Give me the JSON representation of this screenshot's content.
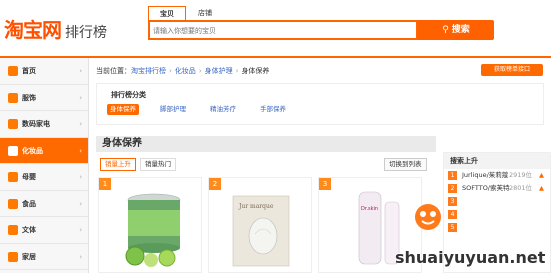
{
  "header": {
    "logo_main": "淘宝网",
    "logo_sub": "排行榜",
    "search_tabs": [
      "宝贝",
      "店铺"
    ],
    "search_placeholder": "请输入你想要的宝贝",
    "search_button": "搜索"
  },
  "sidebar": {
    "items": [
      {
        "label": "首页",
        "arrow": "›"
      },
      {
        "label": "服饰",
        "arrow": "›"
      },
      {
        "label": "数码家电",
        "arrow": "›"
      },
      {
        "label": "化妆品",
        "arrow": "›"
      },
      {
        "label": "母婴",
        "arrow": "›"
      },
      {
        "label": "食品",
        "arrow": "›"
      },
      {
        "label": "文体",
        "arrow": "›"
      },
      {
        "label": "家居",
        "arrow": "›"
      }
    ]
  },
  "main": {
    "breadcrumb": {
      "prefix": "当前位置：",
      "items": [
        "淘宝排行榜",
        "化妆品",
        "身体护理",
        "身体保养"
      ]
    },
    "get_list_button": "获取榜单接口",
    "categories": {
      "title": "排行榜分类",
      "items": [
        "身体保养",
        "脚部护理",
        "精油芳疗",
        "手部保养"
      ]
    },
    "section_title": "身体保养",
    "sort_tabs": [
      "销量上升",
      "销量热门"
    ],
    "switch_label": "切换到列表",
    "products": [
      {
        "rank": "1"
      },
      {
        "rank": "2",
        "brand": "Jur marque"
      },
      {
        "rank": "3",
        "brand": "Dr.skin"
      }
    ]
  },
  "rightbox": {
    "title": "搜索上升",
    "rows": [
      {
        "n": "1",
        "name": "Jurlique/茱莉蔻",
        "val": "2919位"
      },
      {
        "n": "2",
        "name": "SOFTTO/索芙特",
        "val": "2801位"
      },
      {
        "n": "3",
        "name": "",
        "val": ""
      },
      {
        "n": "4",
        "name": "",
        "val": ""
      },
      {
        "n": "5",
        "name": "",
        "val": ""
      }
    ]
  },
  "watermark": {
    "text": "shuaiyuyuan.net"
  },
  "colors": {
    "accent": "#ff6600",
    "link": "#3a66c3",
    "sidebar_active": "#ff6a00"
  }
}
